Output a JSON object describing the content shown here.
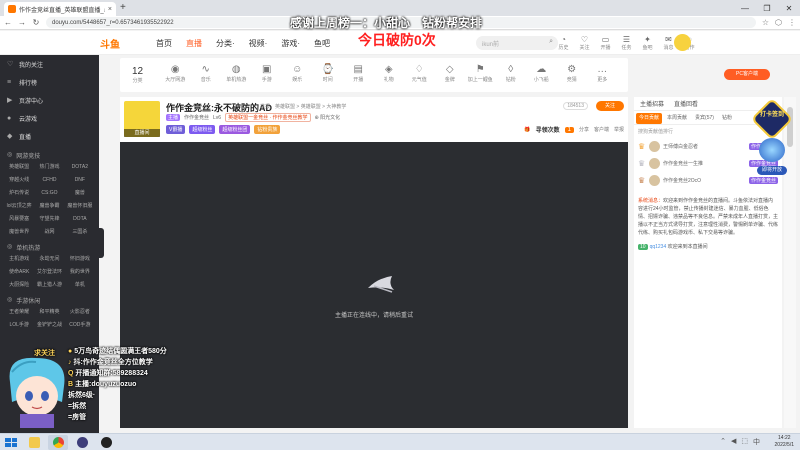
{
  "browser": {
    "tab_title": "作作金竞丝直播_英雄联盟直播_斗鱼直播",
    "tab_close": "×",
    "new_tab": "+",
    "url": "douyu.com/5448657_r=0.6573461935522922",
    "window_controls": [
      "—",
      "❐",
      "✕"
    ]
  },
  "overlay": {
    "top_text": "感谢上周榜一：小甜心　钻粉帮安排",
    "red_text": "今日破防0次",
    "lines": [
      {
        "pre": "●",
        "text": "5万鸟奇迹结偶圆满王者580分"
      },
      {
        "pre": "♪",
        "text": "抖:作作金竞丝全方位教学"
      },
      {
        "pre": "Q",
        "text": "开播通知群:589288324"
      },
      {
        "pre": "B",
        "text": "主播:douyuzuozuo"
      },
      {
        "pre": "",
        "text": "拆然6级·"
      },
      {
        "pre": "",
        "text": "=拆然"
      },
      {
        "pre": "",
        "text": "=房管"
      }
    ],
    "chibi_caption": "求关注"
  },
  "site": {
    "logo": "斗鱼",
    "nav": [
      {
        "label": "首页",
        "active": false
      },
      {
        "label": "直播",
        "active": true
      },
      {
        "label": "分类·",
        "active": false
      },
      {
        "label": "视频·",
        "active": false
      },
      {
        "label": "游戏·",
        "active": false
      },
      {
        "label": "鱼吧",
        "active": false
      }
    ],
    "search_placeholder": "ikun前",
    "header_icons": [
      {
        "glyph": "◔",
        "label": "历史"
      },
      {
        "glyph": "♡",
        "label": "关注"
      },
      {
        "glyph": "▭",
        "label": "开播"
      },
      {
        "glyph": "☰",
        "label": "任务"
      },
      {
        "glyph": "✦",
        "label": "鱼吧"
      },
      {
        "glyph": "✉",
        "label": "消息"
      },
      {
        "glyph": "◌",
        "label": "合作"
      }
    ]
  },
  "sidebar": {
    "top": [
      {
        "icon": "♡",
        "label": "我的关注"
      },
      {
        "icon": "≡",
        "label": "排行榜"
      },
      {
        "icon": "▶",
        "label": "页游中心"
      },
      {
        "icon": "●",
        "label": "云游戏"
      },
      {
        "icon": "◆",
        "label": "直播"
      }
    ],
    "sections": [
      {
        "title": "网游竞技",
        "items": [
          "英雄联盟",
          "热门游戏",
          "DOTA2",
          "穿越火线",
          "CFHD",
          "DNF",
          "炉石传说",
          "CS:GO",
          "魔兽",
          "lol云顶之弈",
          "魔兽争霸",
          "魔兽怀旧服",
          "风暴要塞",
          "守望先锋",
          "DOTA",
          "魔兽世界",
          "战网",
          "三国杀"
        ]
      },
      {
        "title": "单机热游",
        "items": [
          "主机游戏",
          "永劫无间",
          "怀旧游戏",
          "使命ARK",
          "艾尔登法环",
          "我的世界",
          "大厨探险",
          "霸上猎人游",
          "单机"
        ]
      },
      {
        "title": "手游休闲",
        "items": [
          "王者荣耀",
          "和平精英",
          "火影忍者",
          "LOL手游",
          "金铲铲之战",
          "COD手游"
        ]
      }
    ]
  },
  "categories": {
    "first": {
      "value": "12",
      "label": "分类"
    },
    "items": [
      {
        "glyph": "◉",
        "label": "大厅网游"
      },
      {
        "glyph": "∿",
        "label": "音乐"
      },
      {
        "glyph": "◍",
        "label": "单机热游"
      },
      {
        "glyph": "▣",
        "label": "手游"
      },
      {
        "glyph": "☺",
        "label": "娱乐"
      },
      {
        "glyph": "⌚",
        "label": "时间"
      },
      {
        "glyph": "▤",
        "label": "开播"
      },
      {
        "glyph": "◈",
        "label": "礼物"
      },
      {
        "glyph": "♢",
        "label": "元气值"
      },
      {
        "glyph": "◇",
        "label": "金牌"
      },
      {
        "glyph": "⚑",
        "label": "加上一鲤鱼"
      },
      {
        "glyph": "◊",
        "label": "钻粉"
      },
      {
        "glyph": "☁",
        "label": "小飞船"
      },
      {
        "glyph": "⚙",
        "label": "竞猜"
      },
      {
        "glyph": "…",
        "label": "更多"
      }
    ],
    "pc_badge": "PC客户端"
  },
  "room": {
    "avatar_tag": "直播间",
    "title": "作作金竞丝:永不破防的AD",
    "category": "举报　英雄联盟 > 英雄联盟 > 大神教学",
    "badge": "主播",
    "streamer": "作作金竞丝",
    "level": "Lv6",
    "rank": "英雄联盟一金竞丝 · 作作金竞丝教学",
    "share": "⊕ 阳光文化",
    "tags": [
      {
        "text": "V爵播",
        "color": "#6f5ed8"
      },
      {
        "text": "超级粉丝",
        "color": "#7d5af0"
      },
      {
        "text": "超级粉丝团",
        "color": "#9b59e0"
      },
      {
        "text": "钻粉贵族",
        "color": "#f2a23b"
      }
    ],
    "hot": "184513",
    "follow": "关注",
    "claim_label": "寻领次数",
    "claim_count": "1",
    "actions": [
      "分享",
      "客户端",
      "举报"
    ]
  },
  "video": {
    "message": "主播正在连线中，请稍后重试"
  },
  "rightpanel": {
    "top": [
      "主播招募",
      "直播回看"
    ],
    "tabs": [
      {
        "label": "今日贡献",
        "active": true
      },
      {
        "label": "本周贡献",
        "active": false
      },
      {
        "label": "贵宾(57)",
        "active": false
      },
      {
        "label": "钻粉",
        "active": false
      }
    ],
    "list_head": "搜狗贡献值排行",
    "rank_rows": [
      {
        "name": "王师傅白金忍者",
        "badge": "作作金竞丝"
      },
      {
        "name": "作作金竞丝一生推",
        "badge": "作作金竞丝"
      },
      {
        "name": "作作金竞丝2OcO",
        "badge": "作作金竞丝"
      }
    ],
    "sys_label": "系统消息：",
    "sys_text": "欢迎来到作作金竞丝的直播间。斗鱼依法对直播内容进行24小时监管，禁止传播封建迷信、暴力血腥、低俗色情、招嫖诈骗、违禁品等不良信息。严禁未成年人直播打赏，主播以不正当方式诱导打赏，注意理性消费，警惕刷单诈骗、代练代练、购买礼包码游戏币、私下交易等诈骗。",
    "chat_level": "10",
    "chat_name": "qq1234",
    "chat_text": "欢迎来到本直播间",
    "promo_text": "打卡签到",
    "promo_pill": "即将开放"
  },
  "taskbar": {
    "tray": [
      "⌃",
      "◀",
      "⬚",
      "中"
    ],
    "time": "14:22",
    "date": "2022/5/1"
  }
}
